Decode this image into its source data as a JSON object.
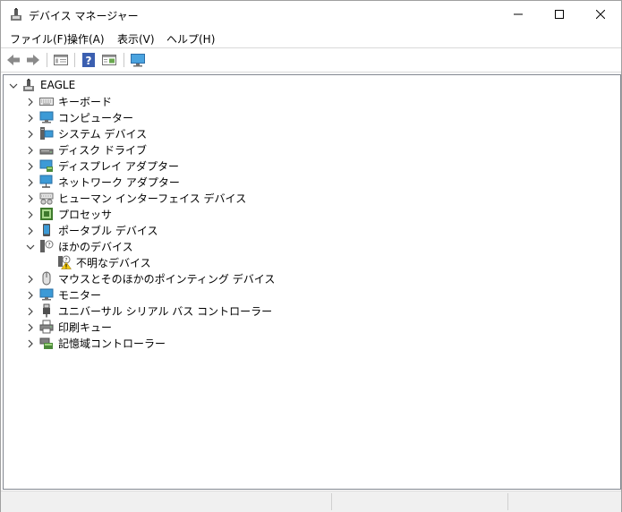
{
  "window": {
    "title": "デバイス マネージャー"
  },
  "menu": [
    {
      "label": "ファイル(F)"
    },
    {
      "label": "操作(A)"
    },
    {
      "label": "表示(V)"
    },
    {
      "label": "ヘルプ(H)"
    }
  ],
  "toolbar": {
    "icons": [
      "back-arrow-icon",
      "forward-arrow-icon",
      "properties-icon",
      "help-icon",
      "view-icon",
      "monitor-scan-icon"
    ]
  },
  "tree": {
    "root": {
      "label": "EAGLE",
      "expanded": true
    },
    "items": [
      {
        "label": "キーボード",
        "icon": "keyboard-icon",
        "expanded": false
      },
      {
        "label": "コンピューター",
        "icon": "computer-icon",
        "expanded": false
      },
      {
        "label": "システム デバイス",
        "icon": "system-device-icon",
        "expanded": false
      },
      {
        "label": "ディスク ドライブ",
        "icon": "disk-drive-icon",
        "expanded": false
      },
      {
        "label": "ディスプレイ アダプター",
        "icon": "display-adapter-icon",
        "expanded": false
      },
      {
        "label": "ネットワーク アダプター",
        "icon": "network-adapter-icon",
        "expanded": false
      },
      {
        "label": "ヒューマン インターフェイス デバイス",
        "icon": "hid-icon",
        "expanded": false
      },
      {
        "label": "プロセッサ",
        "icon": "processor-icon",
        "expanded": false
      },
      {
        "label": "ポータブル デバイス",
        "icon": "portable-device-icon",
        "expanded": false
      },
      {
        "label": "ほかのデバイス",
        "icon": "other-device-icon",
        "expanded": true,
        "children": [
          {
            "label": "不明なデバイス",
            "icon": "unknown-device-warning-icon"
          }
        ]
      },
      {
        "label": "マウスとそのほかのポインティング デバイス",
        "icon": "mouse-icon",
        "expanded": false
      },
      {
        "label": "モニター",
        "icon": "monitor-icon",
        "expanded": false
      },
      {
        "label": "ユニバーサル シリアル バス コントローラー",
        "icon": "usb-icon",
        "expanded": false
      },
      {
        "label": "印刷キュー",
        "icon": "printer-icon",
        "expanded": false
      },
      {
        "label": "記憶域コントローラー",
        "icon": "storage-controller-icon",
        "expanded": false
      }
    ]
  }
}
